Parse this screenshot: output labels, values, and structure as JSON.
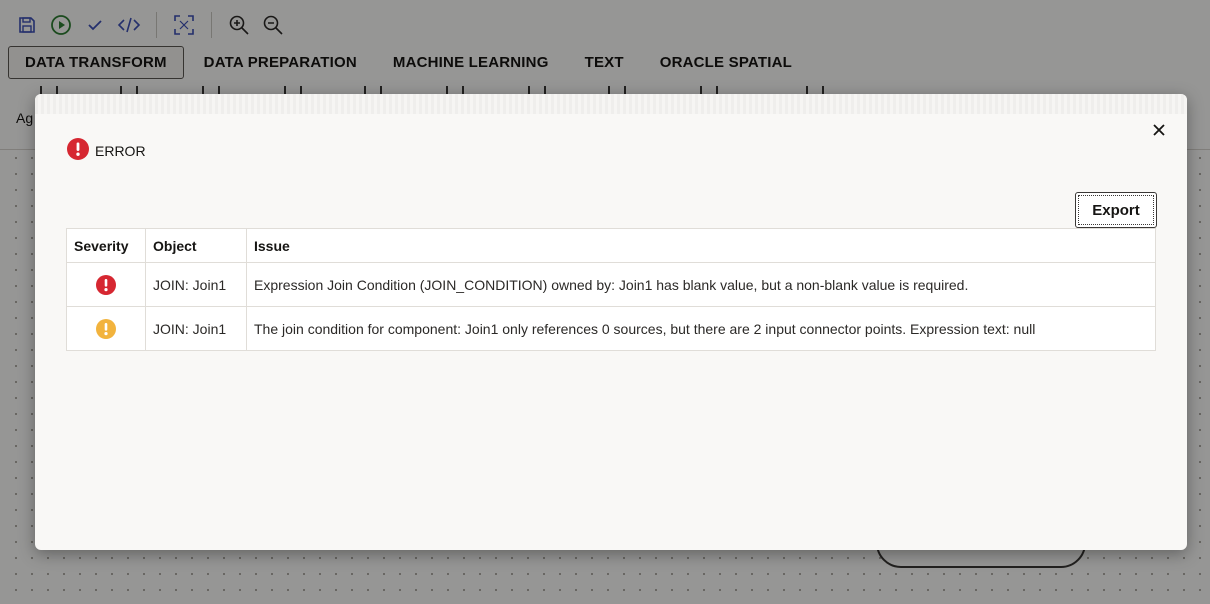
{
  "toolbar": {
    "icons": [
      "save-icon",
      "run-icon",
      "validate-icon",
      "code-icon",
      "fit-to-screen-icon",
      "zoom-in-icon",
      "zoom-out-icon"
    ]
  },
  "tabs": [
    {
      "label": "DATA TRANSFORM",
      "active": true
    },
    {
      "label": "DATA PREPARATION",
      "active": false
    },
    {
      "label": "MACHINE LEARNING",
      "active": false
    },
    {
      "label": "TEXT",
      "active": false
    },
    {
      "label": "ORACLE SPATIAL",
      "active": false
    }
  ],
  "palette": {
    "label_fragment": "Ag"
  },
  "dialog": {
    "title": "ERROR",
    "export_label": "Export",
    "columns": [
      "Severity",
      "Object",
      "Issue"
    ],
    "rows": [
      {
        "severity": "error",
        "object": "JOIN: Join1",
        "issue": "Expression Join Condition (JOIN_CONDITION) owned by: Join1 has blank value, but a non-blank value is required."
      },
      {
        "severity": "warning",
        "object": "JOIN: Join1",
        "issue": "The join condition for component: Join1 only references 0 sources, but there are 2 input connector points. Expression text: null"
      }
    ]
  },
  "colors": {
    "error": "#d62731",
    "warning": "#f2b33d",
    "run": "#2e7d32",
    "accent": "#3c4fb5"
  }
}
